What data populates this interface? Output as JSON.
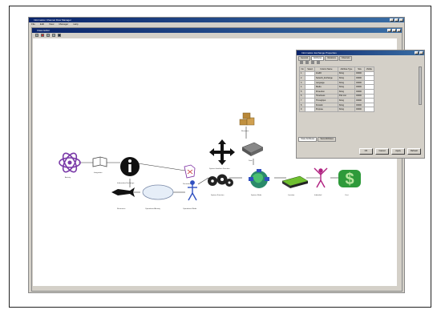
{
  "main_window": {
    "title": "Information Channel Flow Manager",
    "menu": [
      "File",
      "Edit",
      "View",
      "Manager",
      "Help"
    ]
  },
  "editor_window": {
    "title": "Class Editor"
  },
  "properties_window": {
    "title": "Information Exchange Properties",
    "tabs": [
      "General",
      "Attributes",
      "Relations",
      "Channels"
    ],
    "columns": [
      "No",
      "Select",
      "Column Name",
      "Attribute Type",
      "Size",
      "Visible"
    ],
    "rows": [
      {
        "no": "1",
        "name": "IntelID",
        "type": "String",
        "size": "00000"
      },
      {
        "no": "2",
        "name": "Network_Exchange",
        "type": "String",
        "size": "00000"
      },
      {
        "no": "3",
        "name": "Language",
        "type": "String",
        "size": "00000"
      },
      {
        "no": "4",
        "name": "Media",
        "type": "String",
        "size": "00000"
      },
      {
        "no": "5",
        "name": "Protection",
        "type": "String",
        "size": "00000"
      },
      {
        "no": "6",
        "name": "Timeliness",
        "type": "Pick List",
        "size": "00000"
      },
      {
        "no": "7",
        "name": "Throughput",
        "type": "String",
        "size": "00000"
      },
      {
        "no": "8",
        "name": "Periodic",
        "type": "String",
        "size": "00000"
      },
      {
        "no": "9",
        "name": "Purpose",
        "type": "String",
        "size": "00000"
      }
    ],
    "lower_tabs": [
      "Class Attributes",
      "View Attributes"
    ],
    "buttons": [
      "OK",
      "Cancel",
      "Apply",
      "Refresh"
    ]
  },
  "diagram": {
    "labels": {
      "atom": "Activity",
      "book": "Integration",
      "info": "Information Exchange",
      "fish": "Resources",
      "ellipse": "Operational Activity",
      "person": "Operational Node",
      "flag": "Document",
      "gears": "System Function",
      "arrows": "System Interface Function",
      "boxes": "Resource",
      "hdd": "Data",
      "globe": "System Node",
      "table": "Location",
      "dancer": "Individual",
      "dollar": "Cost"
    },
    "colors": {
      "atom": "#7a3aa8",
      "globe": "#2a8a6a",
      "dollar": "#2e9a3a",
      "person": "#3050c0",
      "dancer": "#b02080"
    }
  }
}
